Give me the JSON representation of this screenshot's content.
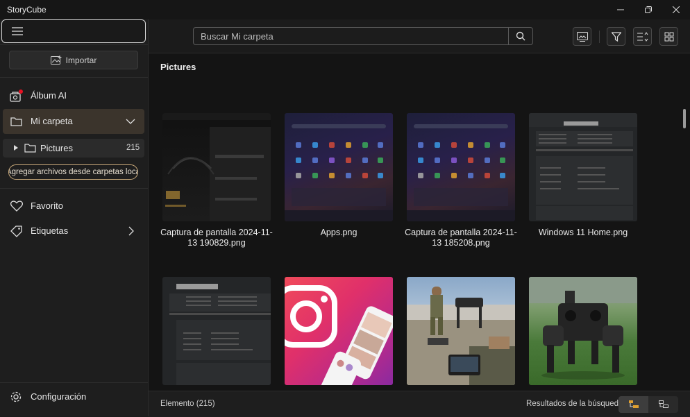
{
  "app": {
    "title": "StoryCube"
  },
  "sidebar": {
    "import_label": "Importar",
    "album_ai": "Álbum AI",
    "my_folder": "Mi carpeta",
    "sub_folder": {
      "label": "Pictures",
      "count": "215"
    },
    "add_folders": "Agregar archivos desde carpetas loca",
    "favorite": "Favorito",
    "tags": "Etiquetas",
    "settings": "Configuración"
  },
  "toolbar": {
    "search_placeholder": "Buscar Mi carpeta"
  },
  "content": {
    "folder_title": "Pictures",
    "items": [
      {
        "caption": "Captura de pantalla 2024-11-13 190829.png",
        "kind": "screenshot-dark"
      },
      {
        "caption": "Apps.png",
        "kind": "start-menu"
      },
      {
        "caption": "Captura de pantalla 2024-11-13 185208.png",
        "kind": "start-menu"
      },
      {
        "caption": "Windows 11 Home.png",
        "kind": "system-info"
      },
      {
        "caption": "",
        "kind": "system-info"
      },
      {
        "caption": "",
        "kind": "instagram"
      },
      {
        "caption": "",
        "kind": "robot-dog-soldier"
      },
      {
        "caption": "",
        "kind": "robot-dog-grass"
      }
    ]
  },
  "status": {
    "left": "Elemento (215)",
    "right": "Resultados de la búsqueda"
  },
  "colors": {
    "accent": "#c9a97a",
    "selected_bg": "#3b342c",
    "badge": "#e81123"
  }
}
